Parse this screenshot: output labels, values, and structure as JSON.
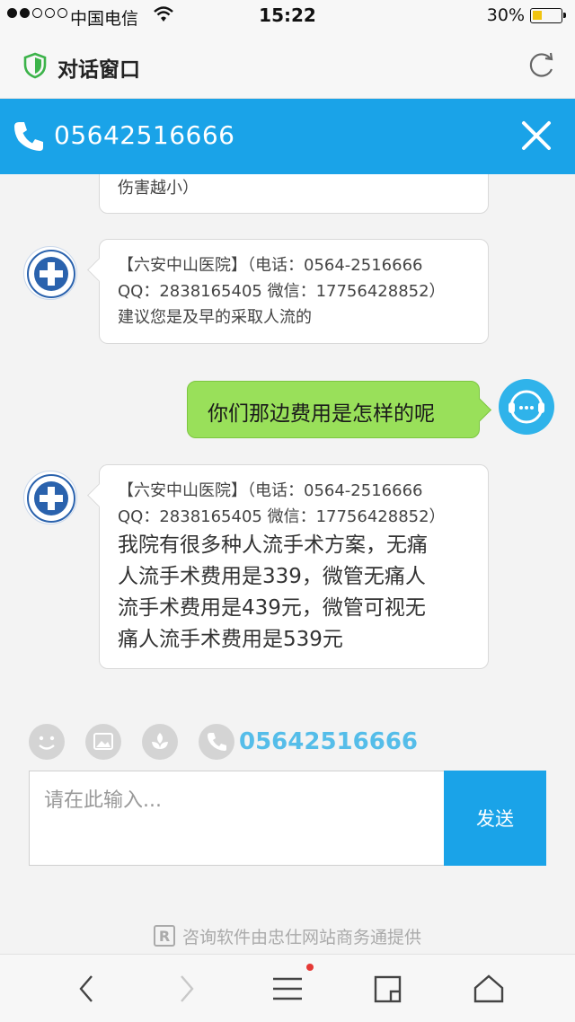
{
  "status_bar": {
    "carrier": "中国电信",
    "time": "15:22",
    "battery": "30%",
    "battery_level": 0.3
  },
  "title_bar": {
    "title": "对话窗口",
    "left_icon": "shield-icon",
    "right_icon": "refresh-icon"
  },
  "phone_header": {
    "number": "05642516666",
    "left_icon": "phone-icon",
    "right_icon": "close-icon"
  },
  "messages": [
    {
      "side": "left",
      "body": "伤害越小）"
    },
    {
      "side": "left",
      "head_line1": "【六安中山医院】（电话：0564-2516666",
      "head_line2": "QQ：2838165405 微信：17756428852）",
      "body": "建议您是及早的采取人流的"
    },
    {
      "side": "right",
      "body": "你们那边费用是怎样的呢"
    },
    {
      "side": "left",
      "head_line1": "【六安中山医院】（电话：0564-2516666",
      "head_line2": "QQ：2838165405 微信：17756428852）",
      "body_lines": [
        "我院有很多种人流手术方案，无痛",
        "人流手术费用是339，微管无痛人",
        "流手术费用是439元，微管可视无",
        "痛人流手术费用是539元"
      ]
    }
  ],
  "toolbar": {
    "icons": [
      "emoji-icon",
      "image-icon",
      "flower-icon",
      "phone-icon"
    ],
    "phone_number": "05642516666"
  },
  "input": {
    "placeholder": "请在此输入...",
    "value": ""
  },
  "send_button": {
    "label": "发送"
  },
  "footer": {
    "badge": "R",
    "text": "咨询软件由忠仕网站商务通提供"
  },
  "colors": {
    "accent": "#1aa3e8",
    "right_bubble": "#99e05a",
    "toolbar_number": "#55bde9",
    "notification_dot": "#e53935",
    "battery": "#f1c40f"
  }
}
